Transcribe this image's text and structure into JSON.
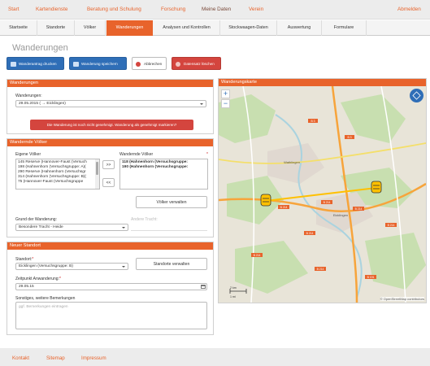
{
  "topnav": {
    "items": [
      "Start",
      "Kartendienste",
      "Beratung und Schulung",
      "Forschung",
      "Meine Daten",
      "Verein"
    ],
    "logout": "Abmelden"
  },
  "subnav": {
    "tabs": [
      "Startseite",
      "Standorte",
      "Völker",
      "Wanderungen",
      "Analysen und Kontrollen",
      "Stockwaagen-Daten",
      "Auswertung",
      "Formulare"
    ]
  },
  "page": {
    "title": "Wanderungen"
  },
  "actions": {
    "print": "Wanderantrag drucken",
    "save": "Wanderung speichern",
    "cancel": "Abbrechen",
    "delete": "Datensatz löschen"
  },
  "wanderungen_panel": {
    "heading": "Wanderungen",
    "label": "Wanderungen:",
    "selected": "29.05.2015 ( → Eicklingen)",
    "alert": "Die Wanderung ist noch nicht genehmigt. Wanderung als genehmigt markieren?"
  },
  "voelker_panel": {
    "heading": "Wandernde Völker",
    "own_label": "Eigene Völker",
    "moving_label": "Wandernde Völker",
    "own_list": [
      "145 Reserve (Hannover-Faust (Versuch",
      "198 (Hahnenhorn (Versuchsgruppe: A)(",
      "290 Reserve (Hahnenhorn (Versuchsgr",
      "314 (Hahnenhorn (Versuchsgruppe: B)(",
      "75 (Hannover-Faust (Versuchsgruppe"
    ],
    "moving_list": [
      "118 (Hahnenhorn (Versuchsgruppe:",
      "190 (Hahnenhorn (Versuchsgruppe:"
    ],
    "add": ">>",
    "remove": "<<",
    "manage": "Völker verwalten",
    "reason_label": "Grund der Wanderung:",
    "reason": "Besondere Tracht - Heide",
    "other_label": "Andere Tracht:"
  },
  "standort_panel": {
    "heading": "Neuer Standort",
    "location_label": "Standort:",
    "location": "Eicklingen (Versuchsgruppe: B)",
    "manage": "Standorte verwalten",
    "time_label": "Zeitpunkt Anwanderung:",
    "time": "29.05.15",
    "notes_label": "Sonstiges, weitere Bemerkungen",
    "notes_placeholder": "ggf. Bemerkungen eintragen"
  },
  "map": {
    "heading": "Wanderungskarte",
    "zoom_in": "+",
    "zoom_out": "−",
    "attribution": "© OpenStreetMap contributors",
    "scale_km": "2 km",
    "scale_mi": "1 mi",
    "roads": [
      "B 214",
      "B 214",
      "B 214",
      "B 214",
      "B 214",
      "B 3",
      "B 3",
      "B 191",
      "L 311",
      "L 310"
    ],
    "places": [
      "Wathlingen",
      "Eicklingen"
    ],
    "colors": {
      "water": "#aad3df",
      "land": "#e8e4d8",
      "forest": "#c8dfb0",
      "residential": "#e0d8d0",
      "route": "#ffc000",
      "major_road": "#f7a43b"
    }
  },
  "footer": {
    "links": [
      "Kontakt",
      "Sitemap",
      "Impressum"
    ]
  }
}
